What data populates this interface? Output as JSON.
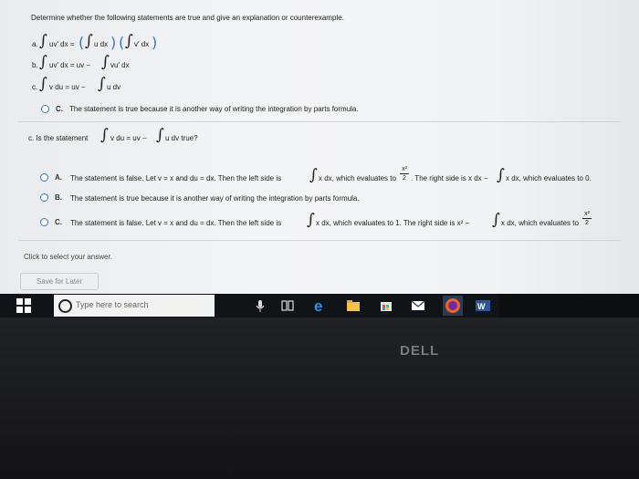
{
  "question": {
    "prompt": "Determine whether the following statements are true and give an explanation or counterexample.",
    "items": [
      {
        "label": "a.",
        "text": "uv′ dx = ",
        "rhs1": "u dx",
        "rhs2": "v′ dx"
      },
      {
        "label": "b.",
        "text": "uv′ dx = uv − ",
        "rhs": "vu′ dx"
      },
      {
        "label": "c.",
        "text": "v du = uv − ",
        "rhs": "u dv"
      }
    ],
    "answer_prev": {
      "label": "C.",
      "text": "The statement is true because it is another way of writing the integration by parts formula."
    },
    "subq": {
      "prefix": "c. Is the statement",
      "mid": "v du = uv −",
      "end": "u dv true?"
    },
    "options": [
      {
        "label": "A.",
        "text1": "The statement is false. Let v = x and du = dx. Then the left side is",
        "text2": "x dx, which evaluates to",
        "frac_num": "x²",
        "frac_den": "2",
        "text3": ". The right side is x dx −",
        "text4": "x dx, which evaluates to 0."
      },
      {
        "label": "B.",
        "text": "The statement is true because it is another way of writing the integration by parts formula."
      },
      {
        "label": "C.",
        "text1": "The statement is false. Let v = x and du = dx. Then the left side is",
        "text2": "x dx, which evaluates to 1. The right side is x² −",
        "text3": "x dx, which evaluates to",
        "frac_num": "x²",
        "frac_den": "2"
      }
    ],
    "hint": "Click to select your answer.",
    "save_label": "Save for Later"
  },
  "taskbar": {
    "search_placeholder": "Type here to search"
  },
  "brand": "DELL",
  "colors": {
    "accent": "#3a76b8",
    "taskbar": "#101418"
  }
}
